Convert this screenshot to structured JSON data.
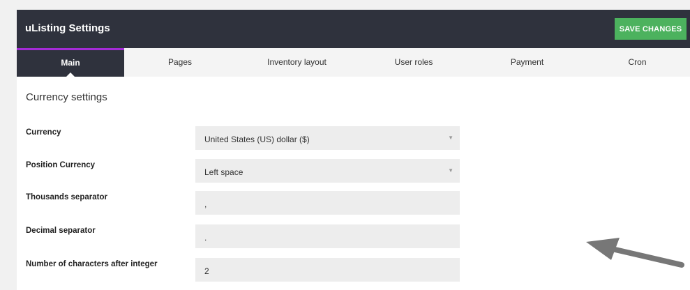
{
  "header": {
    "title": "uListing Settings",
    "save_label": "SAVE CHANGES"
  },
  "tabs": [
    {
      "label": "Main",
      "active": true
    },
    {
      "label": "Pages",
      "active": false
    },
    {
      "label": "Inventory layout",
      "active": false
    },
    {
      "label": "User roles",
      "active": false
    },
    {
      "label": "Payment",
      "active": false
    },
    {
      "label": "Cron",
      "active": false
    }
  ],
  "section": {
    "title": "Currency settings"
  },
  "fields": {
    "currency": {
      "label": "Currency",
      "value": "United States (US) dollar ($)"
    },
    "position": {
      "label": "Position Currency",
      "value": "Left space"
    },
    "thousands": {
      "label": "Thousands separator",
      "value": ","
    },
    "decimal": {
      "label": "Decimal separator",
      "value": "."
    },
    "decimals_count": {
      "label": "Number of characters after integer",
      "value": "2"
    }
  },
  "colors": {
    "header_bg": "#2f323d",
    "accent_tab": "#a42bd6",
    "save_button": "#4cb25e",
    "annotation_arrow": "#777777"
  },
  "icons": {
    "dropdown": "chevron-down-icon",
    "annotation": "annotation-arrow-icon"
  }
}
